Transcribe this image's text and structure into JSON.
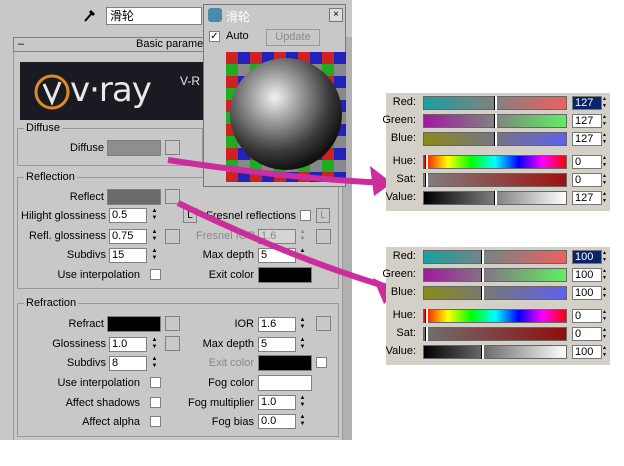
{
  "material": {
    "name": "滑轮",
    "rollout_title": "Basic parame",
    "logo_text": "v·ray",
    "logo_side_text": "V-R"
  },
  "diffuse": {
    "group_title": "Diffuse",
    "label": "Diffuse",
    "color": "#8e8e8e"
  },
  "reflection": {
    "group_title": "Reflection",
    "reflect_label": "Reflect",
    "reflect_color": "#6a6a6a",
    "hilight_label": "Hilight glossiness",
    "hilight_value": "0.5",
    "l_label": "L",
    "fresnel_label": "Fresnel reflections",
    "refl_gloss_label": "Refl. glossiness",
    "refl_gloss_value": "0.75",
    "fresnel_ior_label": "Fresnel IOR",
    "fresnel_ior_value": "1.6",
    "subdivs_label": "Subdivs",
    "subdivs_value": "15",
    "max_depth_label": "Max depth",
    "max_depth_value": "5",
    "use_interp_label": "Use interpolation",
    "exit_color_label": "Exit color",
    "exit_color": "#000000"
  },
  "refraction": {
    "group_title": "Refraction",
    "refract_label": "Refract",
    "refract_color": "#000000",
    "ior_label": "IOR",
    "ior_value": "1.6",
    "glossiness_label": "Glossiness",
    "glossiness_value": "1.0",
    "max_depth_label": "Max depth",
    "max_depth_value": "5",
    "subdivs_label": "Subdivs",
    "subdivs_value": "8",
    "exit_color_label": "Exit color",
    "exit_color": "#000000",
    "use_interp_label": "Use interpolation",
    "fog_color_label": "Fog color",
    "fog_color": "#ffffff",
    "affect_shadows_label": "Affect shadows",
    "fog_mult_label": "Fog multiplier",
    "fog_mult_value": "1.0",
    "affect_alpha_label": "Affect alpha",
    "fog_bias_label": "Fog bias",
    "fog_bias_value": "0.0"
  },
  "preview": {
    "title": "滑轮",
    "auto_label": "Auto",
    "auto_checked": true,
    "update_label": "Update"
  },
  "picker1": {
    "red_label": "Red:",
    "red_value": "127",
    "green_label": "Green:",
    "green_value": "127",
    "blue_label": "Blue:",
    "blue_value": "127",
    "hue_label": "Hue:",
    "hue_value": "0",
    "sat_label": "Sat:",
    "sat_value": "0",
    "value_label": "Value:",
    "value_value": "127"
  },
  "picker2": {
    "red_label": "Red:",
    "red_value": "100",
    "green_label": "Green:",
    "green_value": "100",
    "blue_label": "Blue:",
    "blue_value": "100",
    "hue_label": "Hue:",
    "hue_value": "0",
    "sat_label": "Sat:",
    "sat_value": "0",
    "value_label": "Value:",
    "value_value": "100"
  },
  "colors": {
    "panel_bg": "#c8c8c8",
    "annotation_arrow": "#cc2c9c"
  }
}
